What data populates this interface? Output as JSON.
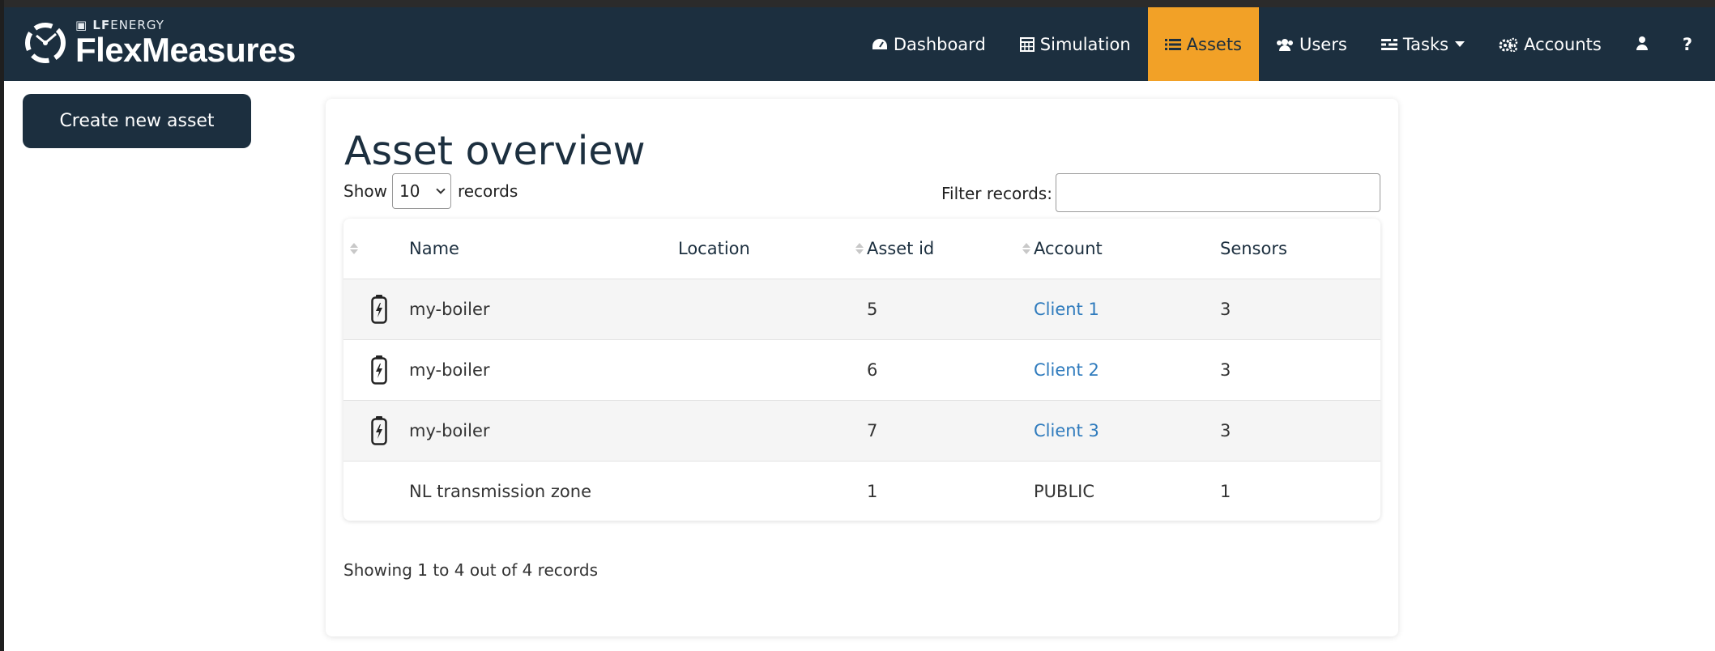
{
  "brand": {
    "small_prefix": "LF",
    "small_suffix": "ENERGY",
    "name": "FlexMeasures"
  },
  "nav": {
    "items": [
      {
        "label": "Dashboard",
        "icon": "dashboard-icon"
      },
      {
        "label": "Simulation",
        "icon": "calculator-icon"
      },
      {
        "label": "Assets",
        "icon": "list-icon",
        "active": true
      },
      {
        "label": "Users",
        "icon": "users-icon"
      },
      {
        "label": "Tasks",
        "icon": "tasks-icon"
      },
      {
        "label": "Accounts",
        "icon": "cogs-icon"
      }
    ],
    "user_icon": "user-icon",
    "help_label": "?"
  },
  "create_button": "Create new asset",
  "title": "Asset overview",
  "length_control": {
    "show": "Show",
    "selected": "10",
    "records": "records"
  },
  "filter": {
    "label": "Filter records:",
    "value": ""
  },
  "table": {
    "headers": [
      "Name",
      "Location",
      "Asset id",
      "Account",
      "Sensors"
    ],
    "rows": [
      {
        "icon": "battery-icon",
        "name": "my-boiler",
        "location": "",
        "asset_id": "5",
        "account": "Client 1",
        "account_link": true,
        "sensors": "3"
      },
      {
        "icon": "battery-icon",
        "name": "my-boiler",
        "location": "",
        "asset_id": "6",
        "account": "Client 2",
        "account_link": true,
        "sensors": "3"
      },
      {
        "icon": "battery-icon",
        "name": "my-boiler",
        "location": "",
        "asset_id": "7",
        "account": "Client 3",
        "account_link": true,
        "sensors": "3"
      },
      {
        "icon": "",
        "name": "NL transmission zone",
        "location": "",
        "asset_id": "1",
        "account": "PUBLIC",
        "account_link": false,
        "sensors": "1"
      }
    ]
  },
  "footer": "Showing 1 to 4 out of 4 records",
  "colors": {
    "navbar": "#1c2f3f",
    "active": "#f2a127",
    "link": "#2f7bbd"
  }
}
